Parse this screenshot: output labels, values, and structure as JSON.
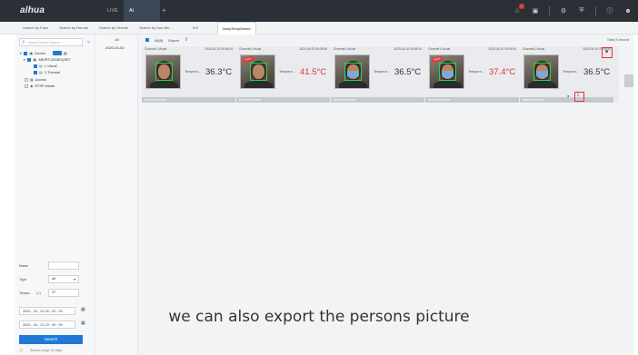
{
  "app": {
    "logo": "alhua"
  },
  "top_tabs": {
    "live": "LIVE",
    "ai_search": "AI SEARCH",
    "add": "+"
  },
  "sub_tabs": [
    "Search by Face",
    "Search by Human",
    "Search by Vehicle",
    "Search by Non-Mo...",
    "IVS",
    "BodyTempDetect"
  ],
  "left": {
    "search_placeholder": "Search Device Search",
    "tree": {
      "device": "Device",
      "nvr": "ABVRT12N4EIQSET",
      "ch1": "1-Visual",
      "ch2": "2-Thermal",
      "access": "Access",
      "rtsp": "RTSP Media"
    },
    "form": {
      "name_label": "Name",
      "type_label": "Type",
      "type_value": "All",
      "temp_label": "Tempe...",
      "temp_op": "(>)",
      "temp_value": "37"
    },
    "start_time": "2020 - 04 - 02  00 : 00 : 00",
    "end_time": "2020 - 04 - 02  23 : 59 : 59",
    "search_button": "Search",
    "range_note": "Search range 30 days"
  },
  "datecol": {
    "header": "All",
    "day": "2020-04-02"
  },
  "toolbar": {
    "select_all": "All(5)",
    "export": "Export"
  },
  "total": "Total 5 record",
  "cards": [
    {
      "channel": "Channel1-Visual",
      "time": "2020-04-02 09:08:34",
      "temp_label": "Tempera...",
      "temp": "36.3°C",
      "hot": false,
      "masked": false,
      "flag": "",
      "footer": "BodyTempDetect"
    },
    {
      "channel": "Channel1-Visual",
      "time": "2020-04-02 09:08:56",
      "temp_label": "Tempera...",
      "temp": "41.5°C",
      "hot": true,
      "masked": false,
      "flag": "Fever",
      "footer": "BodyTempDetect"
    },
    {
      "channel": "Channel1-Visual",
      "time": "2020-04-02 09:09:10",
      "temp_label": "Tempera...",
      "temp": "36.5°C",
      "hot": false,
      "masked": true,
      "flag": "",
      "footer": "BodyTempDetect"
    },
    {
      "channel": "Channel1-Visual",
      "time": "2020-04-02 09:09:34",
      "temp_label": "Tempera...",
      "temp": "37.4°C",
      "hot": true,
      "masked": true,
      "flag": "Fever",
      "footer": "BodyTempDetect"
    },
    {
      "channel": "Channel1-Visual",
      "time": "2020-04-02 09:09:56",
      "temp_label": "Tempera...",
      "temp": "36.5°C",
      "hot": false,
      "masked": true,
      "flag": "",
      "footer": "BodyTempDetect"
    }
  ],
  "caption": "we can also export the persons picture",
  "colors": {
    "accent": "#1e7ad6",
    "hot": "#e3342f",
    "topbar": "#2b2f36",
    "highlight": "#e3342f"
  }
}
